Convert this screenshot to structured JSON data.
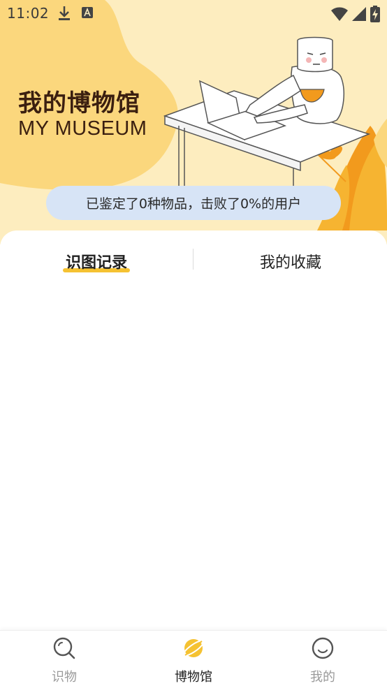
{
  "status_bar": {
    "time": "11:02",
    "icons": [
      "download-icon",
      "text-a-icon",
      "wifi-icon",
      "signal-icon",
      "battery-charging-icon"
    ]
  },
  "hero": {
    "title_cn": "我的博物馆",
    "title_en": "MY MUSEUM",
    "stats_text": "已鉴定了0种物品，击败了0%的用户"
  },
  "tabs": [
    {
      "label": "识图记录",
      "active": true
    },
    {
      "label": "我的收藏",
      "active": false
    }
  ],
  "bottom_nav": [
    {
      "label": "识物",
      "icon": "search-icon",
      "active": false
    },
    {
      "label": "博物馆",
      "icon": "planet-icon",
      "active": true
    },
    {
      "label": "我的",
      "icon": "smile-icon",
      "active": false
    }
  ],
  "colors": {
    "accent": "#f5c232",
    "hero_bg": "#fdedbf",
    "blob": "#fbd77d",
    "pill_bg": "#d7e4f6",
    "leaf_orange": "#f29a1d"
  }
}
